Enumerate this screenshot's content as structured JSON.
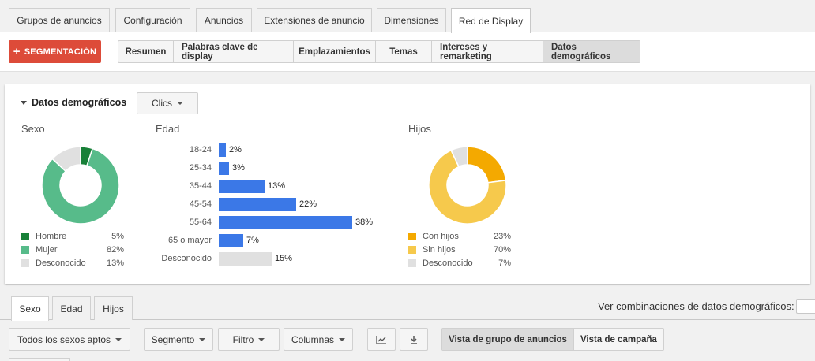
{
  "top_tabs": [
    {
      "label": "Grupos de anuncios"
    },
    {
      "label": "Configuración"
    },
    {
      "label": "Anuncios"
    },
    {
      "label": "Extensiones de anuncio"
    },
    {
      "label": "Dimensiones"
    },
    {
      "label": "Red de Display",
      "active": true
    }
  ],
  "segmentation_button": "SEGMENTACIÓN",
  "sub_tabs": [
    {
      "label": "Resumen"
    },
    {
      "label": "Palabras clave de display"
    },
    {
      "label": "Emplazamientos"
    },
    {
      "label": "Temas"
    },
    {
      "label": "Intereses y remarketing"
    },
    {
      "label": "Datos demográficos",
      "active": true
    }
  ],
  "card": {
    "title": "Datos demográficos",
    "metric_dropdown": "Clics",
    "sexo": {
      "label": "Sexo",
      "legend": [
        {
          "name": "Hombre",
          "pct": "5%",
          "value": 5,
          "color": "#188038"
        },
        {
          "name": "Mujer",
          "pct": "82%",
          "value": 82,
          "color": "#57bb8a"
        },
        {
          "name": "Desconocido",
          "pct": "13%",
          "value": 13,
          "color": "#e0e0e0"
        }
      ]
    },
    "edad": {
      "label": "Edad",
      "rows": [
        {
          "name": "18-24",
          "pct": "2%",
          "value": 2,
          "color": "#3b78e7"
        },
        {
          "name": "25-34",
          "pct": "3%",
          "value": 3,
          "color": "#3b78e7"
        },
        {
          "name": "35-44",
          "pct": "13%",
          "value": 13,
          "color": "#3b78e7"
        },
        {
          "name": "45-54",
          "pct": "22%",
          "value": 22,
          "color": "#3b78e7"
        },
        {
          "name": "55-64",
          "pct": "38%",
          "value": 38,
          "color": "#3b78e7"
        },
        {
          "name": "65 o mayor",
          "pct": "7%",
          "value": 7,
          "color": "#3b78e7"
        },
        {
          "name": "Desconocido",
          "pct": "15%",
          "value": 15,
          "color": "#e0e0e0"
        }
      ]
    },
    "hijos": {
      "label": "Hijos",
      "legend": [
        {
          "name": "Con hijos",
          "pct": "23%",
          "value": 23,
          "color": "#f4a900"
        },
        {
          "name": "Sin hijos",
          "pct": "70%",
          "value": 70,
          "color": "#f6c94c"
        },
        {
          "name": "Desconocido",
          "pct": "7%",
          "value": 7,
          "color": "#e0e0e0"
        }
      ]
    }
  },
  "bottom_tabs": [
    {
      "label": "Sexo",
      "active": true
    },
    {
      "label": "Edad"
    },
    {
      "label": "Hijos"
    }
  ],
  "combinations_label": "Ver combinaciones de datos demográficos:",
  "toolbar": {
    "sex_filter": "Todos los sexos aptos",
    "segment": "Segmento",
    "filter": "Filtro",
    "columns": "Columnas",
    "chart_icon": "line-chart-icon",
    "download_icon": "download-icon",
    "view_adgroup": "Vista de grupo de anuncios",
    "view_campaign": "Vista de campaña"
  }
}
